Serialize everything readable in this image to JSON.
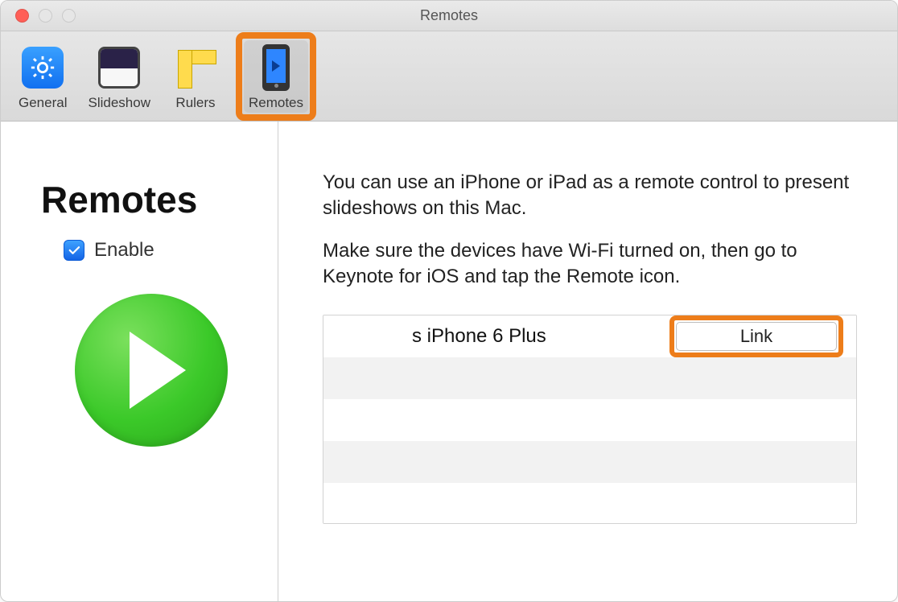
{
  "window": {
    "title": "Remotes"
  },
  "toolbar": {
    "items": [
      {
        "id": "general",
        "label": "General"
      },
      {
        "id": "slideshow",
        "label": "Slideshow"
      },
      {
        "id": "rulers",
        "label": "Rulers"
      },
      {
        "id": "remotes",
        "label": "Remotes"
      }
    ]
  },
  "sidebar": {
    "heading": "Remotes",
    "enable_label": "Enable",
    "enable_checked": true
  },
  "main": {
    "paragraph1": "You can use an iPhone or iPad as a remote control to present slideshows on this Mac.",
    "paragraph2": "Make sure the devices have Wi-Fi turned on, then go to Keynote for iOS and tap the Remote icon.",
    "devices": [
      {
        "name": "s iPhone 6 Plus",
        "link_label": "Link"
      }
    ]
  },
  "highlight": {
    "color": "#ed7d1a"
  }
}
